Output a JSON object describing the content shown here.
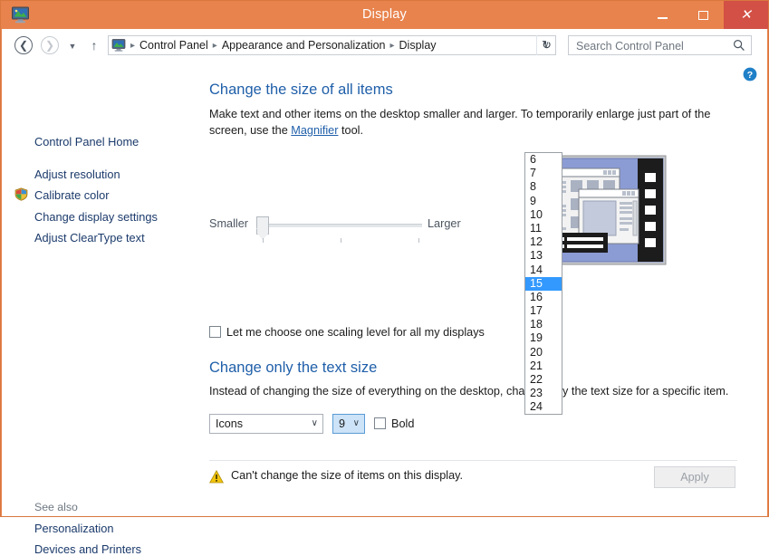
{
  "window": {
    "title": "Display",
    "icon": "display-monitor-icon",
    "minimize_label": "Minimize",
    "maximize_label": "Maximize",
    "close_label": "Close",
    "frame_color": "#e8834d",
    "close_color": "#d25045"
  },
  "nav": {
    "back_label": "Back",
    "forward_label": "Forward",
    "recent_label": "Recent locations",
    "up_label": "Up one level",
    "breadcrumbs": [
      "Control Panel",
      "Appearance and Personalization",
      "Display"
    ],
    "separator": "▸",
    "chevron": "∨",
    "refresh": "↻",
    "help_label": "Help"
  },
  "search": {
    "placeholder": "Search Control Panel",
    "value": ""
  },
  "sidebar": {
    "home": "Control Panel Home",
    "items": [
      {
        "label": "Adjust resolution",
        "icon": null
      },
      {
        "label": "Calibrate color",
        "icon": "shield-icon"
      },
      {
        "label": "Change display settings",
        "icon": null
      },
      {
        "label": "Adjust ClearType text",
        "icon": null
      }
    ],
    "see_also_label": "See also",
    "see_also_items": [
      {
        "label": "Personalization"
      },
      {
        "label": "Devices and Printers"
      }
    ]
  },
  "main": {
    "heading_size": "Change the size of all items",
    "desc_size_part1": "Make text and other items on the desktop smaller and larger. To temporarily enlarge just part of the screen, use the ",
    "desc_size_link": "Magnifier",
    "desc_size_part2": " tool.",
    "slider": {
      "min_label": "Smaller",
      "max_label": "Larger",
      "value_position": 0,
      "ticks": 3
    },
    "scale_checkbox": {
      "label": "Let me choose one scaling level for all my displays",
      "checked": false
    },
    "heading_text_only": "Change only the text size",
    "desc_text_only": "Instead of changing the size of everything on the desktop, change only the text size for a specific item.",
    "item_combo": {
      "value": "Icons",
      "arrow": "∨"
    },
    "size_combo": {
      "value": "9",
      "arrow": "∨",
      "focused": true
    },
    "bold_checkbox": {
      "label": "Bold",
      "checked": false
    },
    "warning": {
      "icon": "warning-triangle-icon",
      "text": "Can't change the size of items on this display."
    },
    "apply_button": {
      "label": "Apply",
      "enabled": false
    },
    "preview_icon": "monitor-preview-image"
  },
  "dropdown": {
    "open": true,
    "selected": "15",
    "selected_color": "#3399ff",
    "options": [
      "6",
      "7",
      "8",
      "9",
      "10",
      "11",
      "12",
      "13",
      "14",
      "15",
      "16",
      "17",
      "18",
      "19",
      "20",
      "21",
      "22",
      "23",
      "24"
    ]
  }
}
